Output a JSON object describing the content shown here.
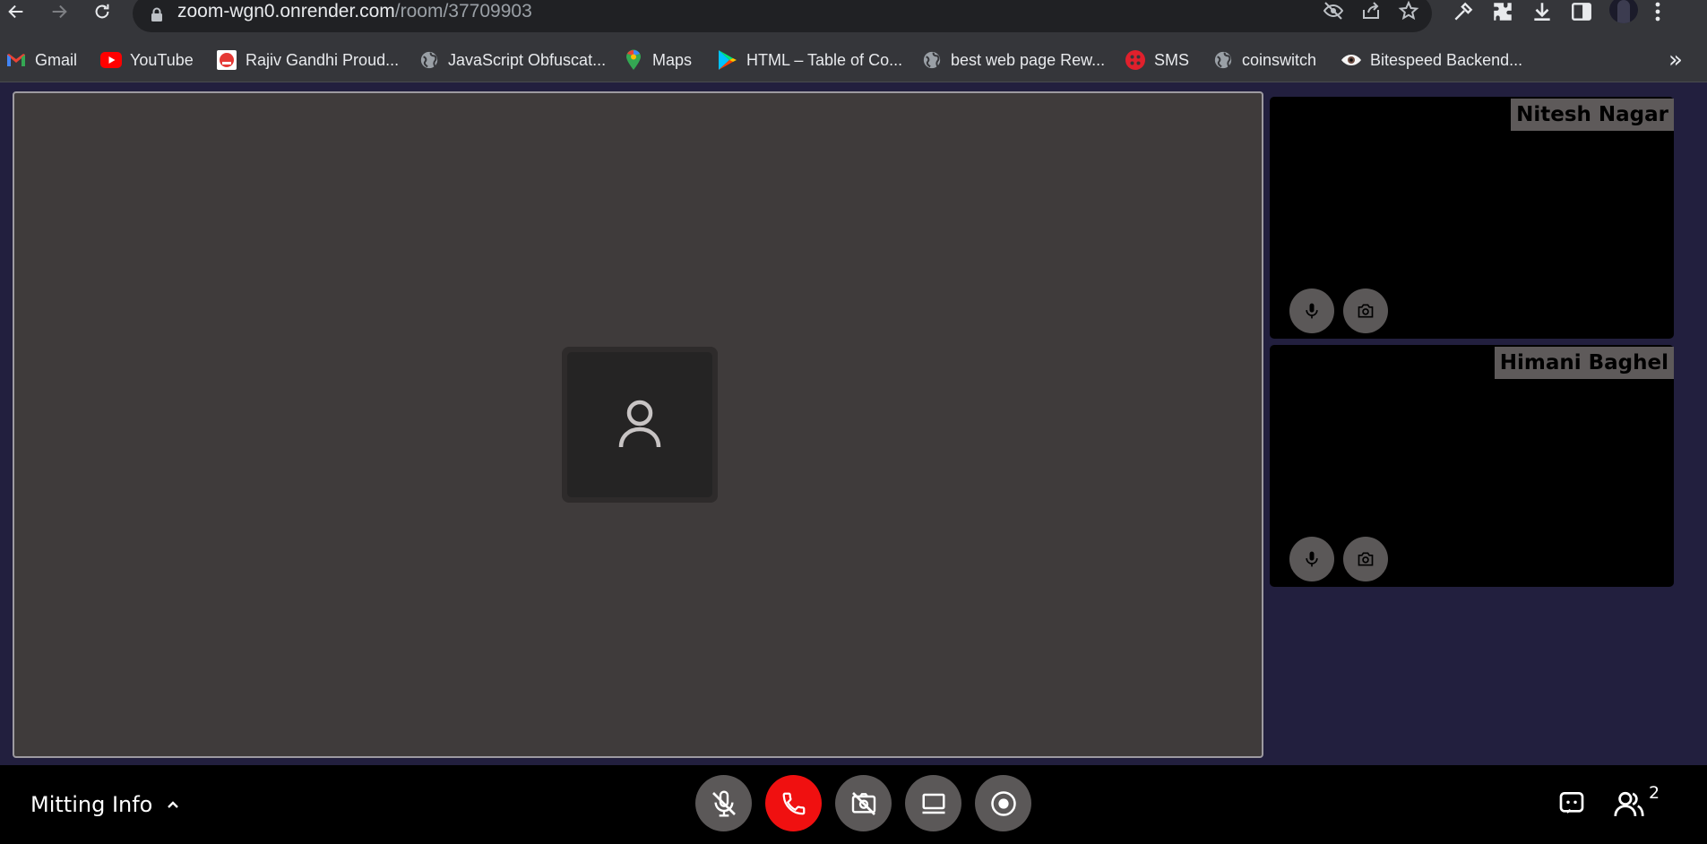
{
  "browser": {
    "url_host": "zoom-wgn0.onrender.com",
    "url_path": "/room/37709903",
    "bookmarks": [
      {
        "label": "Gmail",
        "icon": "gmail-icon"
      },
      {
        "label": "YouTube",
        "icon": "youtube-icon"
      },
      {
        "label": "Rajiv Gandhi Proud...",
        "icon": "university-logo-icon"
      },
      {
        "label": "JavaScript Obfuscat...",
        "icon": "globe-icon"
      },
      {
        "label": "Maps",
        "icon": "maps-pin-icon"
      },
      {
        "label": "HTML – Table of Co...",
        "icon": "play-store-icon"
      },
      {
        "label": "best web page Rew...",
        "icon": "globe-icon"
      },
      {
        "label": "SMS",
        "icon": "sms-icon"
      },
      {
        "label": "coinswitch",
        "icon": "globe-icon"
      },
      {
        "label": "Bitespeed Backend...",
        "icon": "eye-icon"
      }
    ],
    "overflow": "»"
  },
  "participants": [
    {
      "name": "Nitesh Nagar"
    },
    {
      "name": "Himani Baghel"
    }
  ],
  "bottom_bar": {
    "meeting_info_label": "Mitting Info",
    "participant_count": "2"
  },
  "colors": {
    "app_background": "#221f3e",
    "main_tile": "#3f3b3b",
    "end_call": "#f01010",
    "control_button": "#5b5858"
  }
}
